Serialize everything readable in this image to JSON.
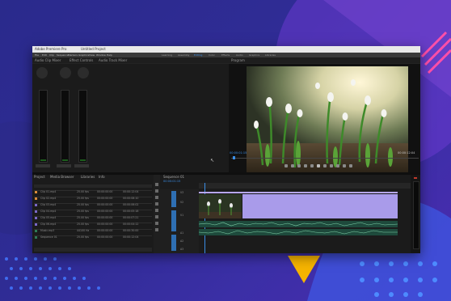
{
  "window": {
    "app_title": "Adobe Premiere Pro",
    "project_name": "Untitled Project",
    "menus": [
      "File",
      "Edit",
      "Clip",
      "Sequence",
      "Markers",
      "Graphics",
      "View",
      "Window",
      "Help"
    ]
  },
  "workspace_tabs": [
    "Learning",
    "Assembly",
    "Editing",
    "Color",
    "Effects",
    "Audio",
    "Graphics",
    "Libraries"
  ],
  "top_left_panel": {
    "tabs": [
      "Audio Clip Mixer",
      "Effect Controls",
      "Audio Track Mixer"
    ]
  },
  "program_monitor": {
    "tab": "Program",
    "timecode_in": "00:00:01:15",
    "timecode_out": "00:00:12:04",
    "image_subject": "snowdrop flowers"
  },
  "project_panel": {
    "tabs": [
      "Project",
      "Media Browser",
      "Libraries",
      "Info"
    ],
    "rows": [
      {
        "name": "Clip 01.mp4",
        "rate": "25.00 fps",
        "start": "00:00:00:00",
        "end": "00:00:12:04"
      },
      {
        "name": "Clip 02.mp4",
        "rate": "25.00 fps",
        "start": "00:00:00:00",
        "end": "00:00:08:10"
      },
      {
        "name": "Clip 03.mp4",
        "rate": "25.00 fps",
        "start": "00:00:00:00",
        "end": "00:00:06:02"
      },
      {
        "name": "Clip 04.mp4",
        "rate": "25.00 fps",
        "start": "00:00:00:00",
        "end": "00:00:05:18"
      },
      {
        "name": "Clip 05.mp4",
        "rate": "25.00 fps",
        "start": "00:00:00:00",
        "end": "00:00:07:21"
      },
      {
        "name": "Clip 06.mp4",
        "rate": "25.00 fps",
        "start": "00:00:00:00",
        "end": "00:00:04:12"
      },
      {
        "name": "Music.mp3",
        "rate": "44100 Hz",
        "start": "00:00:00:00",
        "end": "00:00:30:00"
      },
      {
        "name": "Sequence 01",
        "rate": "25.00 fps",
        "start": "00:00:00:00",
        "end": "00:00:12:04"
      }
    ]
  },
  "timeline": {
    "tab": "Sequence 01",
    "timecode": "00:00:01:15",
    "tracks": [
      "V3",
      "V2",
      "V1",
      "A1",
      "A2",
      "A3"
    ]
  },
  "colors": {
    "clip_purple": "#a99bea",
    "track_blue": "#2e6fb3",
    "audio_green": "#2f7a56",
    "accent_blue": "#3a8ee6"
  }
}
